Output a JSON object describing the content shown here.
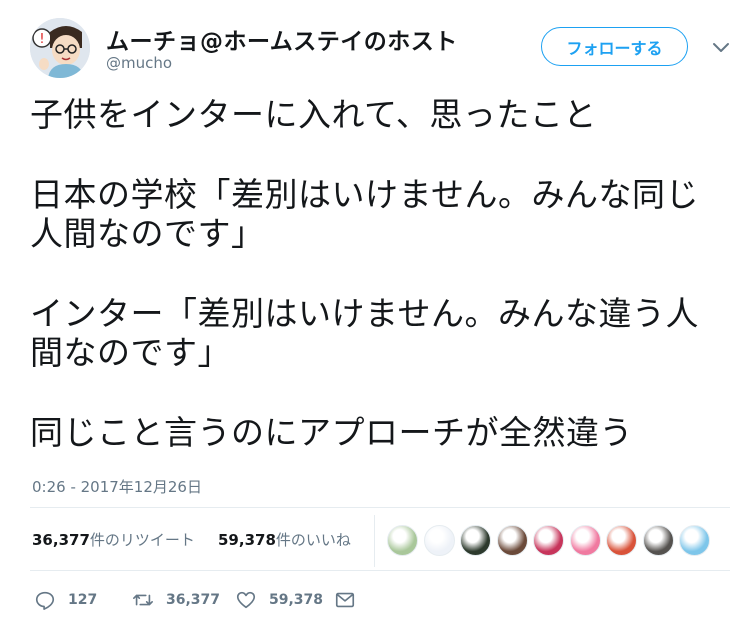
{
  "user": {
    "display_name": "ムーチョ@ホームステイのホスト",
    "handle": "@mucho"
  },
  "follow_button_label": "フォローする",
  "tweet": {
    "lines": [
      "子供をインターに入れて、思ったこと",
      "日本の学校「差別はいけません。みんな同じ",
      "人間なのです」",
      "インター「差別はいけません。みんな違う人",
      "間なのです」",
      "同じこと言うのにアプローチが全然違う"
    ],
    "timestamp": "0:26 - 2017年12月26日"
  },
  "stats": {
    "retweets_count": "36,377",
    "retweets_label": "件のリツイート",
    "likes_count": "59,378",
    "likes_label": "件のいいね"
  },
  "likers": [
    {
      "color": "#a9c79a",
      "icon": "avatar-1"
    },
    {
      "color": "#eef2f8",
      "icon": "avatar-2"
    },
    {
      "color": "#2d3a2d",
      "icon": "avatar-3"
    },
    {
      "color": "#6b4a3a",
      "icon": "avatar-4"
    },
    {
      "color": "#c7355b",
      "icon": "avatar-5"
    },
    {
      "color": "#f07aa0",
      "icon": "avatar-6"
    },
    {
      "color": "#d9533a",
      "icon": "avatar-7"
    },
    {
      "color": "#55524f",
      "icon": "avatar-8"
    },
    {
      "color": "#7ec6ea",
      "icon": "avatar-9"
    }
  ],
  "actions": {
    "reply_count": "127",
    "retweet_count": "36,377",
    "like_count": "59,378"
  },
  "colors": {
    "accent": "#1da1f2",
    "muted": "#657786",
    "text": "#14171a",
    "divider": "#e6ecf0"
  }
}
